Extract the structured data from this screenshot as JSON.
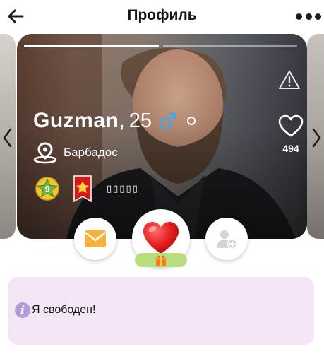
{
  "header": {
    "title": "Профиль",
    "back_icon": "arrow-left-icon",
    "menu_icon": "more-horizontal-icon"
  },
  "profile": {
    "name": "Guzman",
    "name_separator": ",",
    "age": "25",
    "gender_icon": "male-icon",
    "gender_color": "#4aa3e6",
    "location": "Барбадос",
    "location_icon": "map-pin-icon",
    "likes_count": "494",
    "photo_count": 2,
    "photo_index": 1,
    "badges": [
      {
        "icon": "level-star-badge-icon",
        "value": "9"
      },
      {
        "icon": "ribbon-star-badge-icon"
      }
    ],
    "badge_text": "▯▯▯▯▯"
  },
  "actions": {
    "message_icon": "envelope-icon",
    "like_icon": "heart-icon",
    "gift_icon": "gift-icon",
    "add_friend_icon": "add-user-icon"
  },
  "status": {
    "text": "Я свободен!",
    "icon": "info-icon"
  },
  "colors": {
    "accent_heart": "#e51d1d",
    "message_orange": "#f6b23a",
    "gift_pill": "#b7dd7e",
    "status_bg": "#f2e6f5",
    "info_icon": "#b79ad6"
  }
}
